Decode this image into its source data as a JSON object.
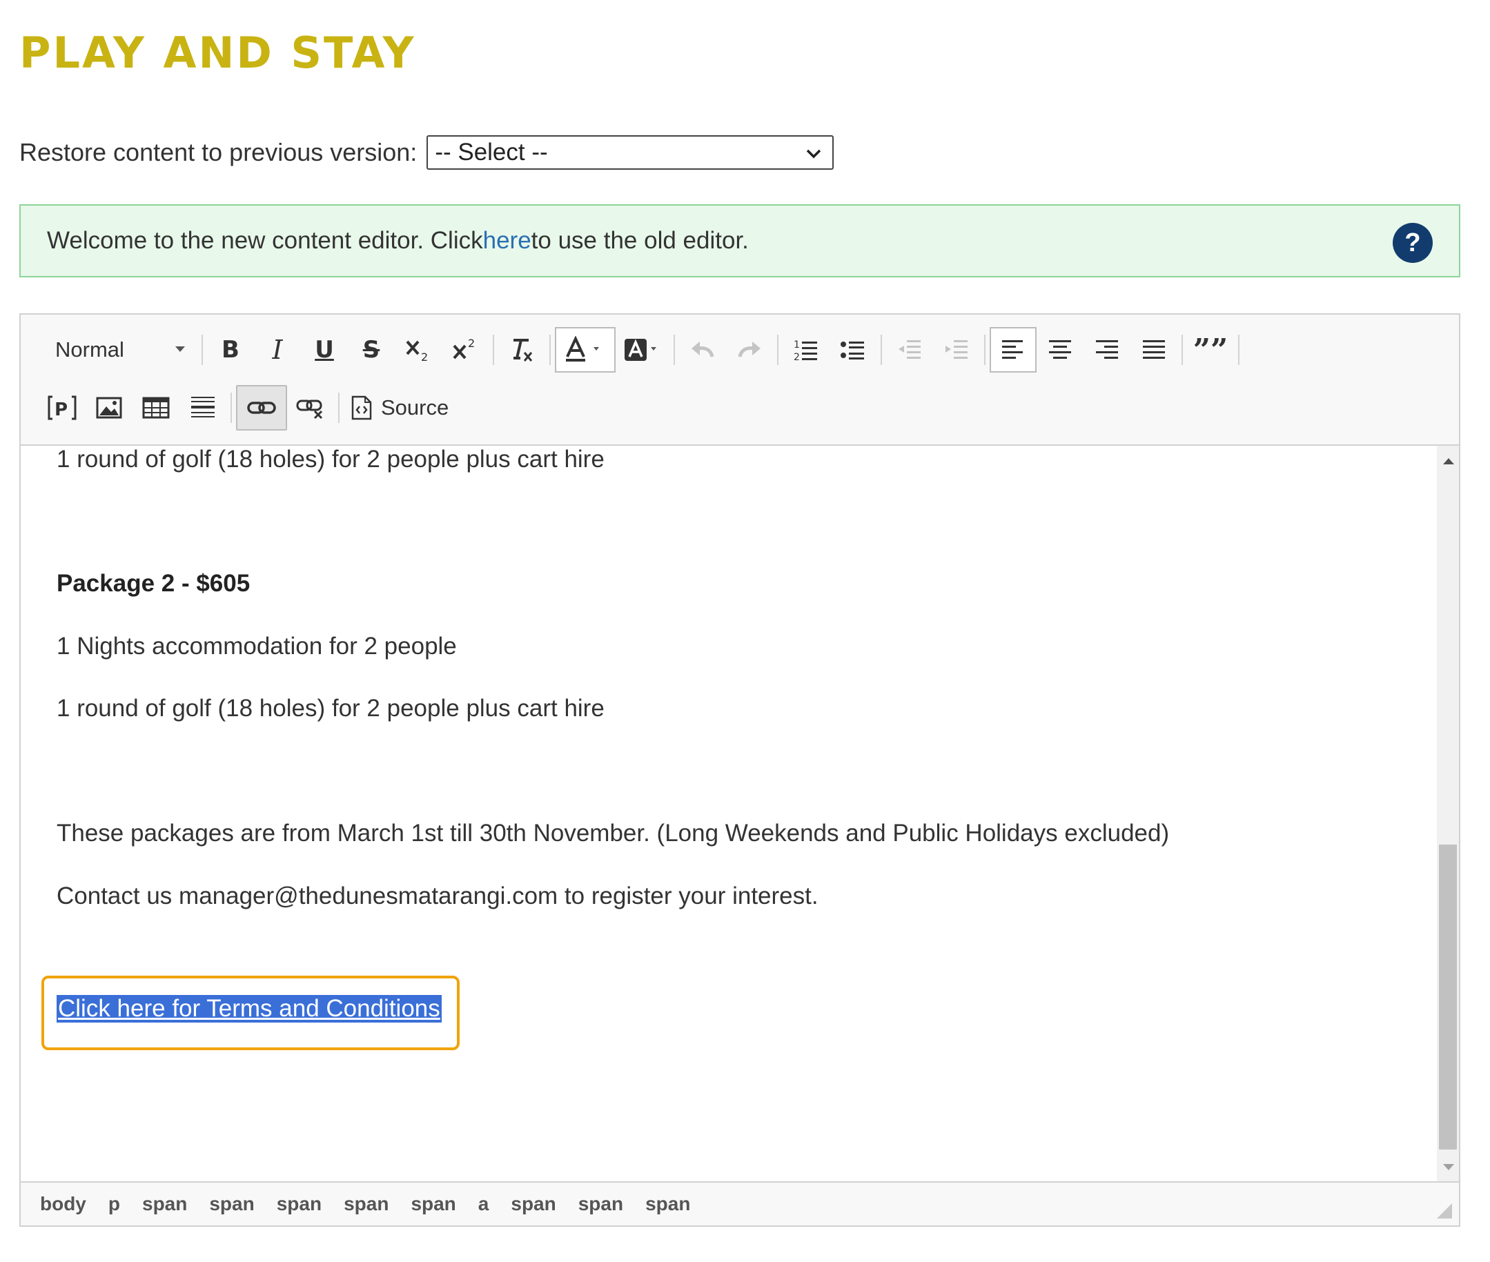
{
  "page": {
    "title": "PLAY AND STAY",
    "restore_label": "Restore content to previous version:",
    "restore_selected": "-- Select --"
  },
  "welcome": {
    "text_before": "Welcome to the new content editor. Click ",
    "link_text": "here",
    "text_after": " to use the old editor.",
    "help_glyph": "?"
  },
  "toolbar": {
    "format_label": "Normal",
    "bold": "B",
    "italic": "I",
    "underline": "U",
    "strike": "S",
    "quote": "”",
    "source_label": "Source",
    "icons": [
      "format-dropdown-icon",
      "bold-icon",
      "italic-icon",
      "underline-icon",
      "strikethrough-icon",
      "subscript-icon",
      "superscript-icon",
      "remove-format-icon",
      "text-color-icon",
      "background-color-icon",
      "undo-icon",
      "redo-icon",
      "numbered-list-icon",
      "bulleted-list-icon",
      "decrease-indent-icon",
      "increase-indent-icon",
      "align-left-icon",
      "align-center-icon",
      "align-right-icon",
      "justify-icon",
      "blockquote-icon",
      "placeholder-icon",
      "image-icon",
      "table-icon",
      "horizontal-line-icon",
      "link-icon",
      "unlink-icon",
      "source-icon"
    ]
  },
  "content": {
    "line1": "1 round of golf (18 holes) for 2 people plus cart hire",
    "package_heading": "Package 2 - $605",
    "line2": "1 Nights accommodation for 2 people",
    "line3": "1 round of golf (18 holes) for 2 people plus cart hire",
    "line4": "These packages are from March 1st till 30th November. (Long Weekends and Public Holidays excluded)",
    "line5": "Contact us manager@thedunesmatarangi.com to register your interest.",
    "terms_link": "Click here for Terms and Conditions"
  },
  "statusbar": {
    "path": [
      "body",
      "p",
      "span",
      "span",
      "span",
      "span",
      "span",
      "a",
      "span",
      "span",
      "span"
    ]
  },
  "colors": {
    "title": "#c8b312",
    "welcome_bg": "#e8f8ea",
    "welcome_border": "#8fd49a",
    "link": "#2a6fb3",
    "help_bg": "#123c6e",
    "selection_bg": "#3a6fd8",
    "highlight_border": "#f0a30a"
  }
}
